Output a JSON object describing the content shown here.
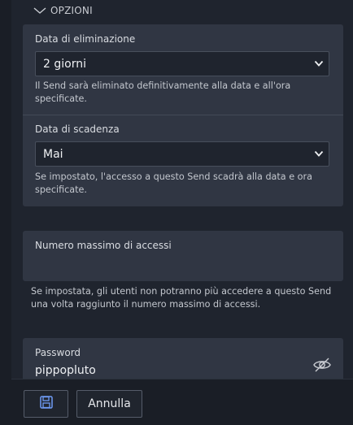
{
  "options_section": {
    "title": "OPZIONI",
    "icon": "chevron-down-icon"
  },
  "deletion": {
    "label": "Data di eliminazione",
    "selected": "2 giorni",
    "help": "Il Send sarà eliminato definitivamente alla data e all'ora specificate."
  },
  "expiration": {
    "label": "Data di scadenza",
    "selected": "Mai",
    "help": "Se impostato, l'accesso a questo Send scadrà alla data e ora specificate."
  },
  "max_access": {
    "label": "Numero massimo di accessi",
    "value": "",
    "help": "Se impostata, gli utenti non potranno più accedere a questo Send una volta raggiunto il numero massimo di accessi."
  },
  "password": {
    "label": "Password",
    "value": "pippopluto",
    "toggle_icon": "eye-slash-icon"
  },
  "footer": {
    "save_icon": "floppy-disk-icon",
    "cancel_label": "Annulla"
  },
  "colors": {
    "background": "#1f242e",
    "card": "#303643",
    "footer": "#1a1e26",
    "accent": "#6f9bf5"
  }
}
